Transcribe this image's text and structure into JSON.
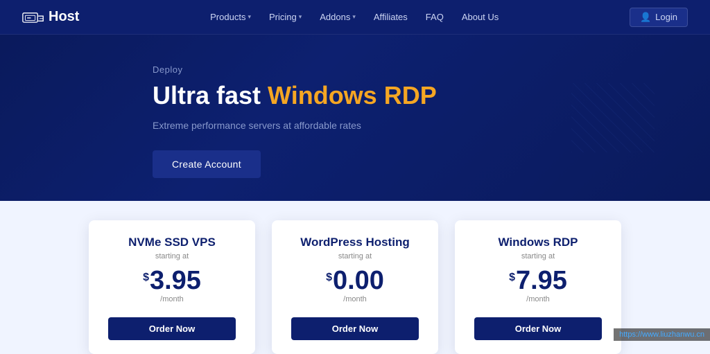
{
  "brand": {
    "name": "Host",
    "logo_alt": "eHost logo"
  },
  "nav": {
    "links": [
      {
        "label": "Products",
        "has_dropdown": true,
        "name": "nav-products"
      },
      {
        "label": "Pricing",
        "has_dropdown": true,
        "name": "nav-pricing"
      },
      {
        "label": "Addons",
        "has_dropdown": true,
        "name": "nav-addons"
      },
      {
        "label": "Affiliates",
        "has_dropdown": false,
        "name": "nav-affiliates"
      },
      {
        "label": "FAQ",
        "has_dropdown": false,
        "name": "nav-faq"
      },
      {
        "label": "About Us",
        "has_dropdown": false,
        "name": "nav-about"
      }
    ],
    "login_label": "Login"
  },
  "hero": {
    "deploy_label": "Deploy",
    "title_plain": "Ultra fast ",
    "title_highlight": "Windows RDP",
    "subtitle": "Extreme performance servers at affordable rates",
    "cta_label": "Create Account"
  },
  "pricing_cards": [
    {
      "title": "NVMe SSD VPS",
      "subtitle": "starting at",
      "price_dollar": "$",
      "price": "3.95",
      "period": "/month",
      "btn_label": "Order Now"
    },
    {
      "title": "WordPress Hosting",
      "subtitle": "starting at",
      "price_dollar": "$",
      "price": "0.00",
      "period": "/month",
      "btn_label": "Order Now"
    },
    {
      "title": "Windows RDP",
      "subtitle": "starting at",
      "price_dollar": "$",
      "price": "7.95",
      "period": "/month",
      "btn_label": "Order Now"
    }
  ],
  "watermark": {
    "url": "https://www.liuzhanwu.cn"
  }
}
